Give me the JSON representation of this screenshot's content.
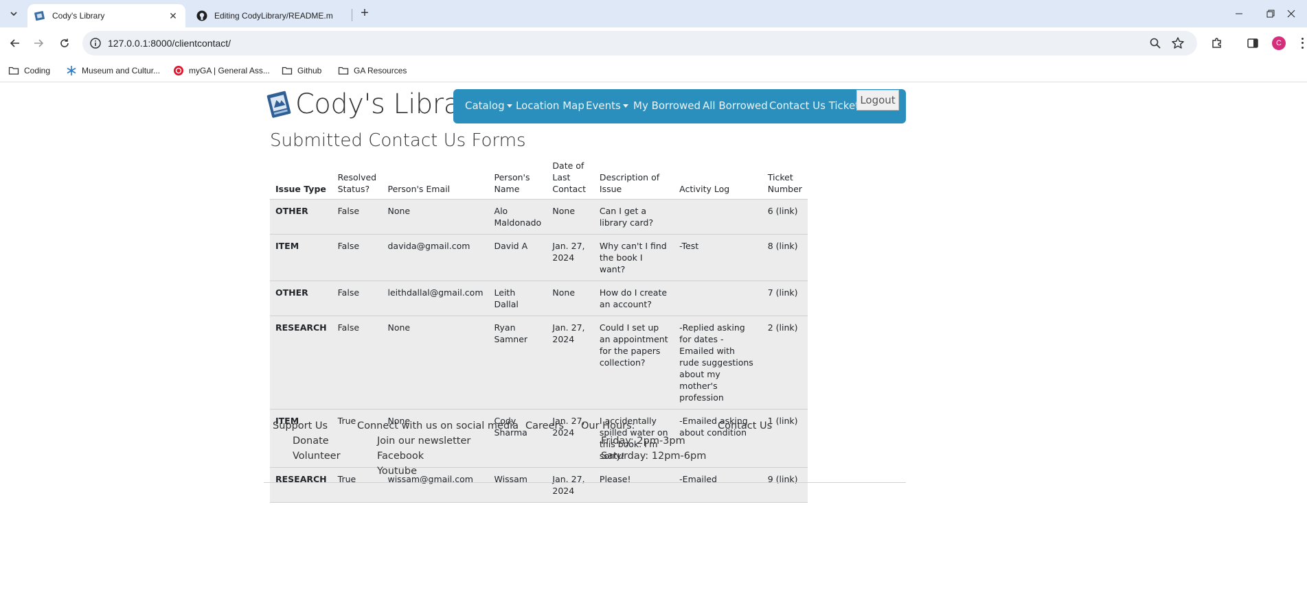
{
  "browser": {
    "tabs": [
      {
        "title": "Cody's Library",
        "active": true
      },
      {
        "title": "Editing CodyLibrary/README.m",
        "active": false
      }
    ],
    "url": "127.0.0.1:8000/clientcontact/",
    "profile_initial": "C",
    "bookmarks": [
      "Coding",
      "Museum and Cultur...",
      "myGA | General Ass...",
      "Github",
      "GA Resources"
    ]
  },
  "site": {
    "brand": "Cody's Library",
    "nav": {
      "catalog": "Catalog",
      "location_map": "Location Map",
      "events": "Events",
      "my_borrowed": "My Borrowed",
      "all_borrowed": "All Borrowed",
      "contact_tickets": "Contact Us Tickets",
      "logout": "Logout"
    },
    "accent": "#2a8fbd"
  },
  "page": {
    "title": "Submitted Contact Us Forms"
  },
  "table": {
    "headers": [
      "Issue Type",
      "Resolved Status?",
      "Person's Email",
      "Person's Name",
      "Date of Last Contact",
      "Description of Issue",
      "Activity Log",
      "Ticket Number"
    ],
    "rows": [
      [
        "OTHER",
        "False",
        "None",
        "Alo Maldonado",
        "None",
        "Can I get a library card?",
        "",
        "6 (link)"
      ],
      [
        "ITEM",
        "False",
        "davida@gmail.com",
        "David A",
        "Jan. 27, 2024",
        "Why can't I find the book I want?",
        "-Test",
        "8 (link)"
      ],
      [
        "OTHER",
        "False",
        "leithdallal@gmail.com",
        "Leith Dallal",
        "None",
        "How do I create an account?",
        "",
        "7 (link)"
      ],
      [
        "RESEARCH",
        "False",
        "None",
        "Ryan Samner",
        "Jan. 27, 2024",
        "Could I set up an appointment for the papers collection?",
        "-Replied asking for dates -Emailed with rude suggestions about my mother's profession",
        "2 (link)"
      ],
      [
        "ITEM",
        "True",
        "None",
        "Cody Sharma",
        "Jan. 27, 2024",
        "I accidentally spilled water on this book. I'm sorry!",
        "-Emailed asking about condition",
        "1 (link)"
      ],
      [
        "RESEARCH",
        "True",
        "wissam@gmail.com",
        "Wissam",
        "Jan. 27, 2024",
        "Please!",
        "-Emailed",
        "9 (link)"
      ]
    ]
  },
  "footer": {
    "support": {
      "heading": "Support Us",
      "items": [
        "Donate",
        "Volunteer"
      ]
    },
    "social": {
      "heading": "Connect with us on social media",
      "items": [
        "Join our newsletter",
        "Facebook",
        "Youtube"
      ]
    },
    "careers": "Careers",
    "hours": {
      "heading": "Our Hours:",
      "items": [
        "Friday: 2pm-3pm",
        "Saturday: 12pm-6pm"
      ]
    },
    "contact": "Contact Us"
  }
}
